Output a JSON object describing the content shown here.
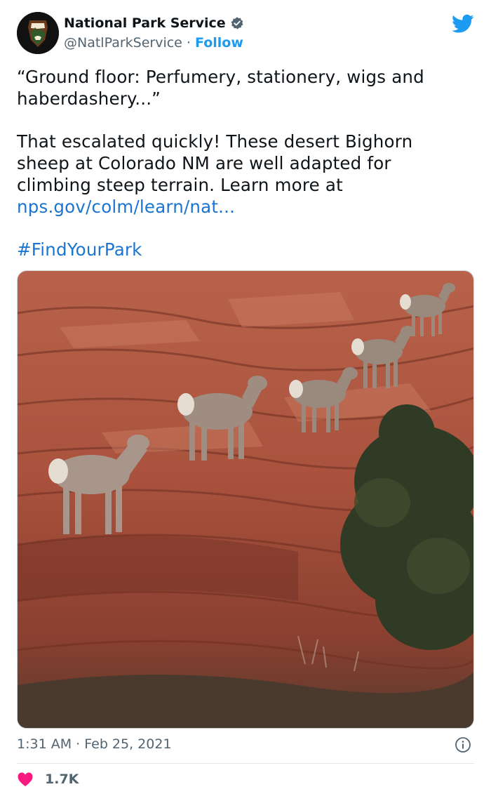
{
  "author": {
    "name": "National Park Service",
    "handle": "@NatlParkService",
    "separator": "·",
    "follow_label": "Follow"
  },
  "tweet": {
    "quote": "“Ground floor: Perfumery, stationery, wigs and haberdashery...”",
    "body": "That escalated quickly! These desert Bighorn sheep at Colorado NM are well adapted for climbing steep terrain. Learn more at",
    "link": "nps.gov/colm/learn/nat...",
    "hashtag": "#FindYourPark"
  },
  "footer": {
    "time": "1:31 AM",
    "separator": "·",
    "date": "Feb 25, 2021",
    "like_count": "1.7K"
  },
  "icons": {
    "verified": "verified-badge-icon",
    "twitter": "twitter-bird-icon",
    "info": "info-icon",
    "heart": "heart-icon"
  },
  "colors": {
    "accent": "#1d9bf0",
    "link": "#1b75d0",
    "heart": "#f91880",
    "muted": "#536471"
  }
}
